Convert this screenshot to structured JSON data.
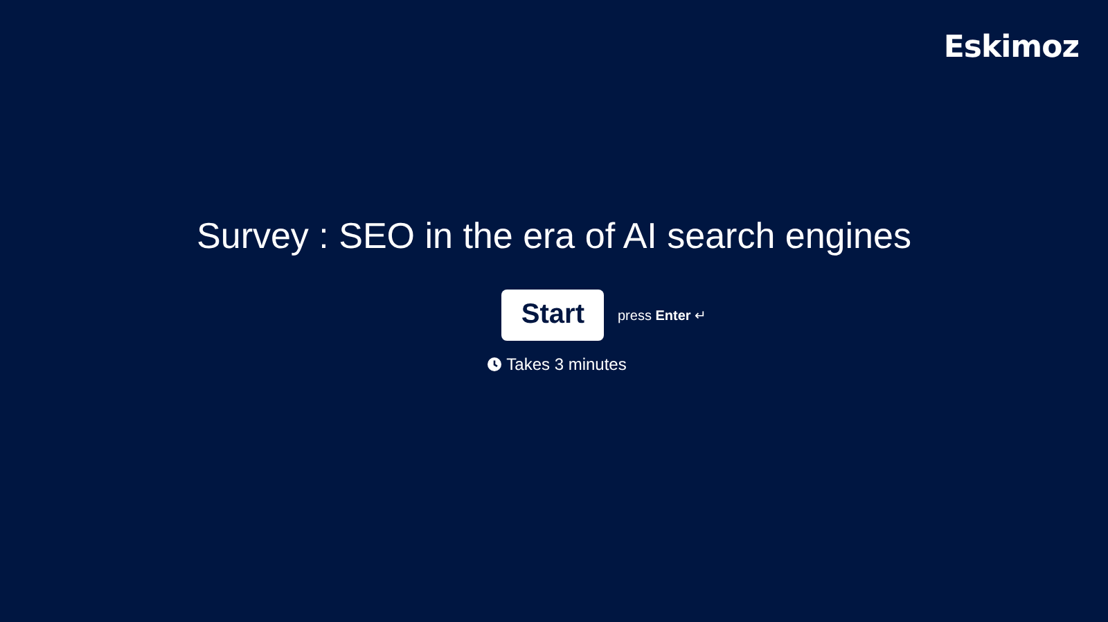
{
  "logo": "Eskimoz",
  "title": "Survey : SEO in the era of AI search engines",
  "start_button": "Start",
  "key_hint": "press **Enter** ↵",
  "duration": "Takes 3 minutes"
}
